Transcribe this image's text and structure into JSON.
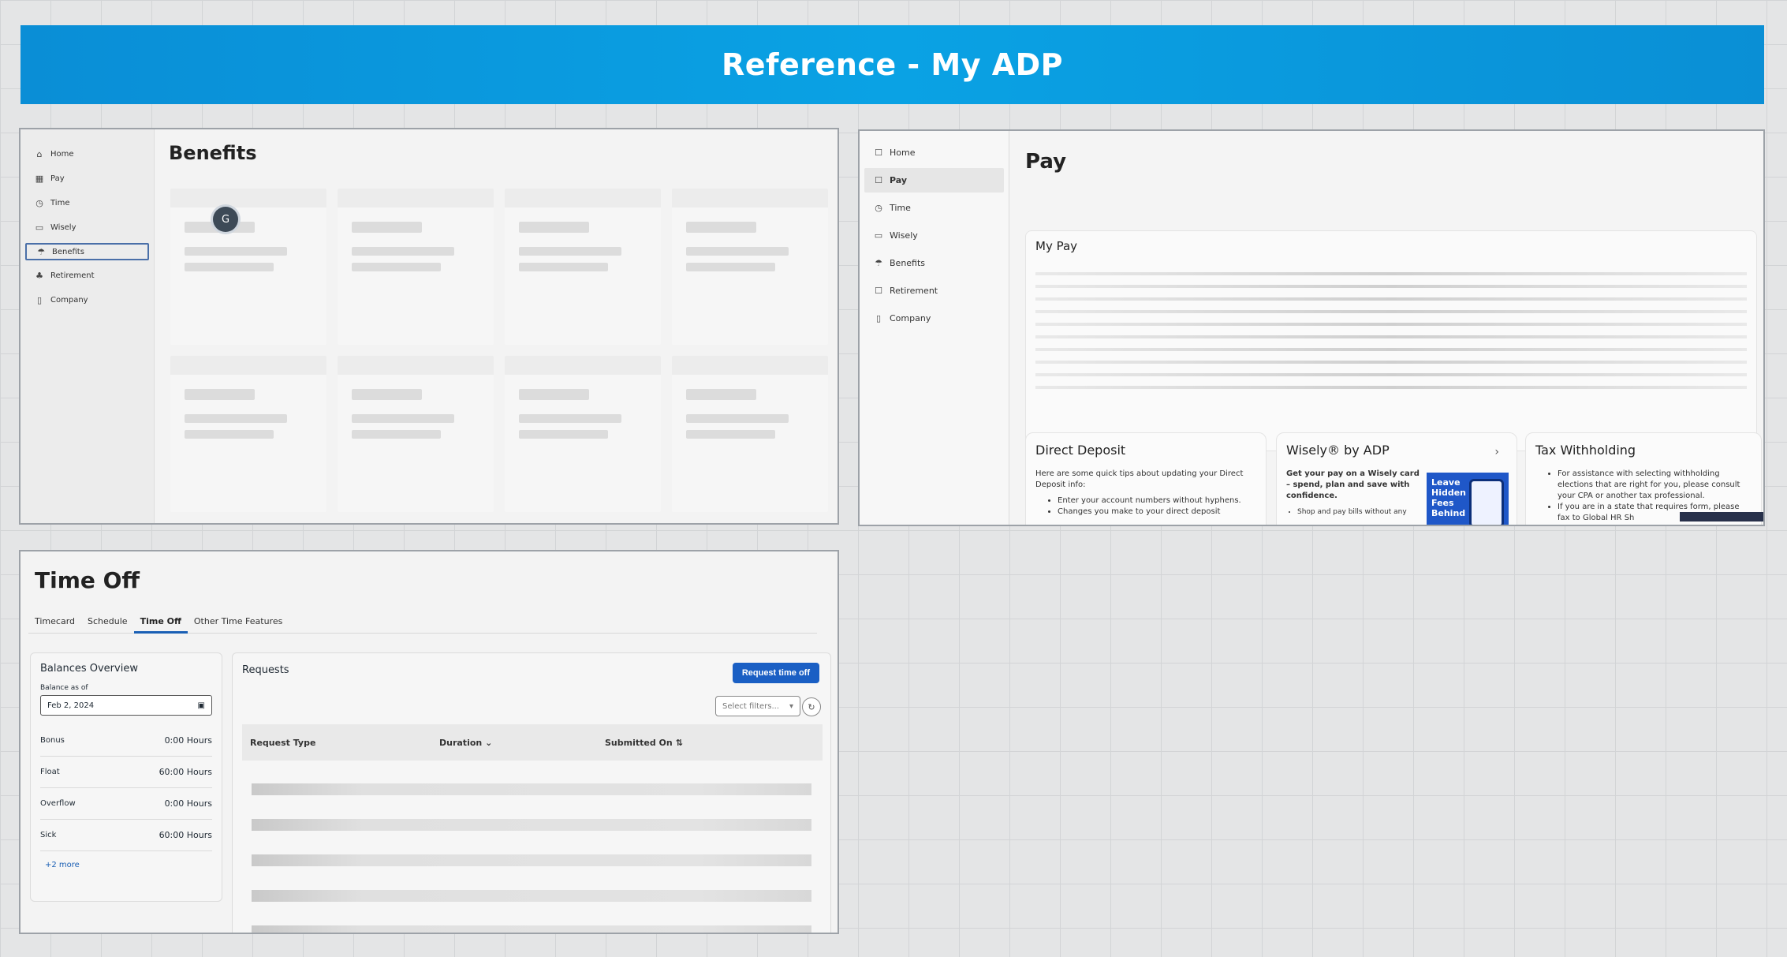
{
  "banner": {
    "title": "Reference - My ADP"
  },
  "benefits_view": {
    "title": "Benefits",
    "avatar_initial": "G",
    "nav": [
      {
        "label": "Home",
        "icon": "home-icon",
        "glyph": "⌂"
      },
      {
        "label": "Pay",
        "icon": "cash-icon",
        "glyph": "▦"
      },
      {
        "label": "Time",
        "icon": "clock-icon",
        "glyph": "◷"
      },
      {
        "label": "Wisely",
        "icon": "card-icon",
        "glyph": "▭"
      },
      {
        "label": "Benefits",
        "icon": "umbrella-icon",
        "glyph": "☂"
      },
      {
        "label": "Retirement",
        "icon": "piggy-bank-icon",
        "glyph": "♣"
      },
      {
        "label": "Company",
        "icon": "building-icon",
        "glyph": "▯"
      }
    ],
    "active": "Benefits"
  },
  "pay_view": {
    "title": "Pay",
    "nav": [
      {
        "label": "Home",
        "icon": "home-icon",
        "glyph": "☐"
      },
      {
        "label": "Pay",
        "icon": "cash-icon",
        "glyph": "☐"
      },
      {
        "label": "Time",
        "icon": "clock-icon",
        "glyph": "◷"
      },
      {
        "label": "Wisely",
        "icon": "card-icon",
        "glyph": "▭"
      },
      {
        "label": "Benefits",
        "icon": "umbrella-icon",
        "glyph": "☂"
      },
      {
        "label": "Retirement",
        "icon": "piggy-bank-icon",
        "glyph": "☐"
      },
      {
        "label": "Company",
        "icon": "building-icon",
        "glyph": "▯"
      }
    ],
    "active": "Pay",
    "my_pay_title": "My Pay",
    "direct_deposit": {
      "title": "Direct Deposit",
      "intro": "Here are some quick tips about updating your Direct Deposit info:",
      "tips": [
        "Enter your account numbers without hyphens.",
        "Changes you make to your direct deposit"
      ]
    },
    "wisely": {
      "title": "Wisely® by ADP",
      "body": "Get your pay on a Wisely card – spend, plan and  save with confidence.",
      "bullet": "Shop and pay bills without any",
      "image_text": "Leave Hidden Fees Behind"
    },
    "tax": {
      "title": "Tax Withholding",
      "tips": [
        "For assistance with selecting withholding elections that are right for you, please consult your CPA or another tax professional.",
        "If you are in a state that requires form, please fax to Global HR Sh"
      ]
    }
  },
  "time_off_view": {
    "title": "Time Off",
    "tabs": [
      "Timecard",
      "Schedule",
      "Time Off",
      "Other Time Features"
    ],
    "active_tab": "Time Off",
    "balances": {
      "title": "Balances Overview",
      "as_of_label": "Balance as of",
      "date": "Feb 2, 2024",
      "rows": [
        {
          "name": "Bonus",
          "value": "0:00 Hours"
        },
        {
          "name": "Float",
          "value": "60:00 Hours"
        },
        {
          "name": "Overflow",
          "value": "0:00 Hours"
        },
        {
          "name": "Sick",
          "value": "60:00 Hours"
        }
      ],
      "more": "+2 more"
    },
    "requests": {
      "title": "Requests",
      "button": "Request time off",
      "filter_placeholder": "Select filters...",
      "columns": [
        "Request Type",
        "Duration",
        "Submitted On"
      ]
    }
  }
}
